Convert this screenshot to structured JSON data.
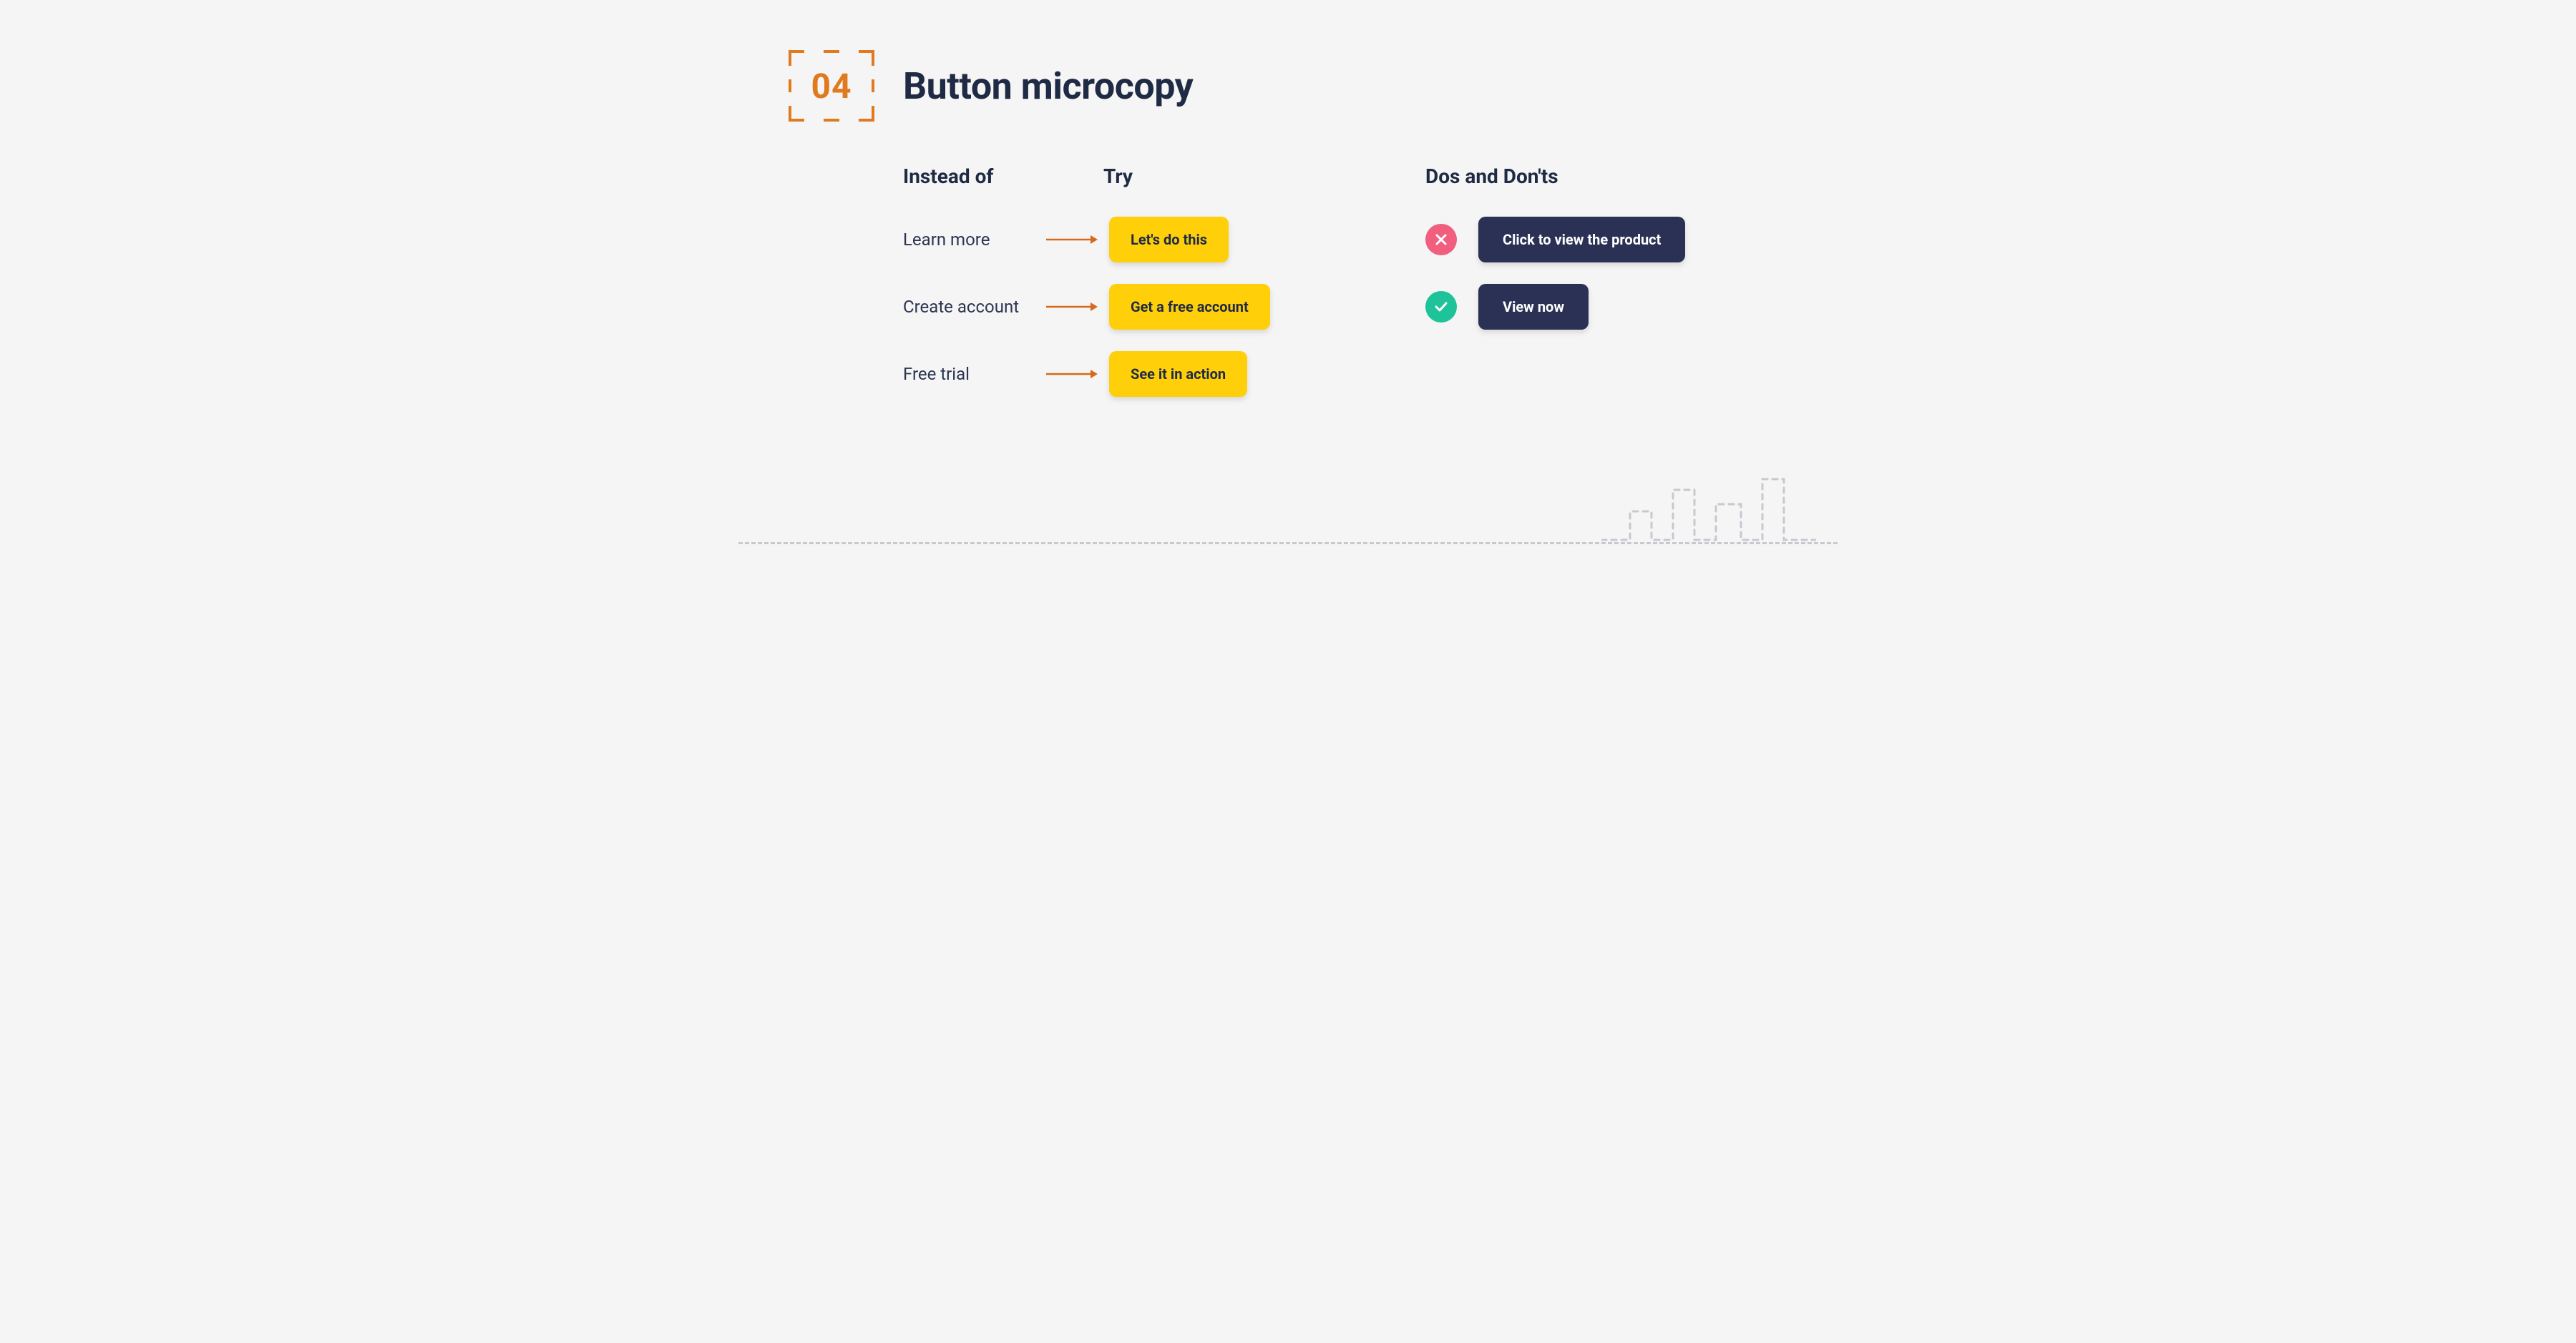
{
  "header": {
    "number": "04",
    "title": "Button microcopy"
  },
  "columns": {
    "instead_of": "Instead of",
    "try": "Try",
    "dos_donts": "Dos and Don'ts"
  },
  "rows": [
    {
      "instead": "Learn more",
      "try": "Let's do this"
    },
    {
      "instead": "Create account",
      "try": "Get a free account"
    },
    {
      "instead": "Free trial",
      "try": "See it in action"
    }
  ],
  "dos_donts": [
    {
      "kind": "dont",
      "label": "Click to view the product"
    },
    {
      "kind": "do",
      "label": "View now"
    }
  ],
  "colors": {
    "accent_orange": "#e07a1f",
    "button_yellow": "#ffcf0a",
    "button_dark": "#2b3154",
    "badge_x": "#f15e7e",
    "badge_check": "#1fc39a"
  }
}
